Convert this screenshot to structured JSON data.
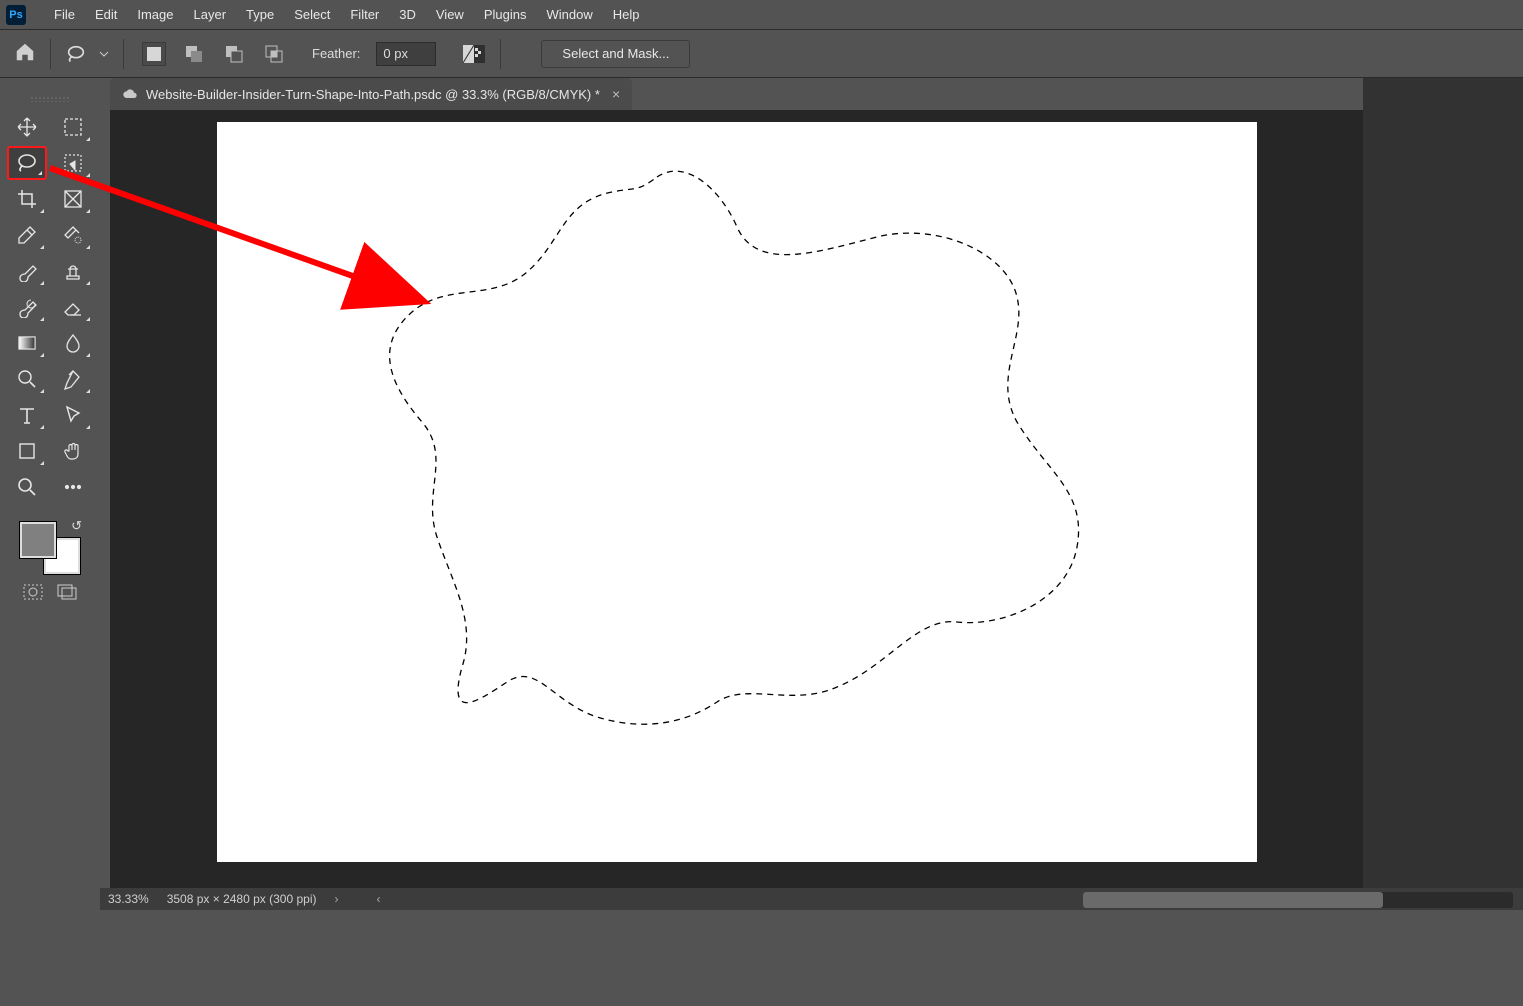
{
  "menu": {
    "items": [
      "File",
      "Edit",
      "Image",
      "Layer",
      "Type",
      "Select",
      "Filter",
      "3D",
      "View",
      "Plugins",
      "Window",
      "Help"
    ]
  },
  "options": {
    "feather_label": "Feather:",
    "feather_value": "0 px",
    "select_and_mask": "Select and Mask..."
  },
  "tab": {
    "title": "Website-Builder-Insider-Turn-Shape-Into-Path.psdc @ 33.3% (RGB/8/CMYK) *"
  },
  "tools": {
    "list": [
      "move-tool",
      "marquee-tool",
      "lasso-tool",
      "object-selection-tool",
      "crop-tool",
      "frame-tool",
      "eyedropper-tool",
      "healing-brush-tool",
      "brush-tool",
      "clone-stamp-tool",
      "history-brush-tool",
      "eraser-tool",
      "gradient-tool",
      "blur-tool",
      "dodge-tool",
      "pen-tool",
      "type-tool",
      "path-selection-tool",
      "shape-tool",
      "hand-tool",
      "zoom-tool",
      "more-tools"
    ],
    "selected": "lasso-tool"
  },
  "colors": {
    "fg": "#808080",
    "bg": "#ffffff"
  },
  "status": {
    "zoom": "33.33%",
    "dims": "3508 px × 2480 px (300 ppi)"
  },
  "annotation": {
    "arrow_from_tool": "lasso-tool",
    "arrow_to": "selection-on-canvas"
  }
}
